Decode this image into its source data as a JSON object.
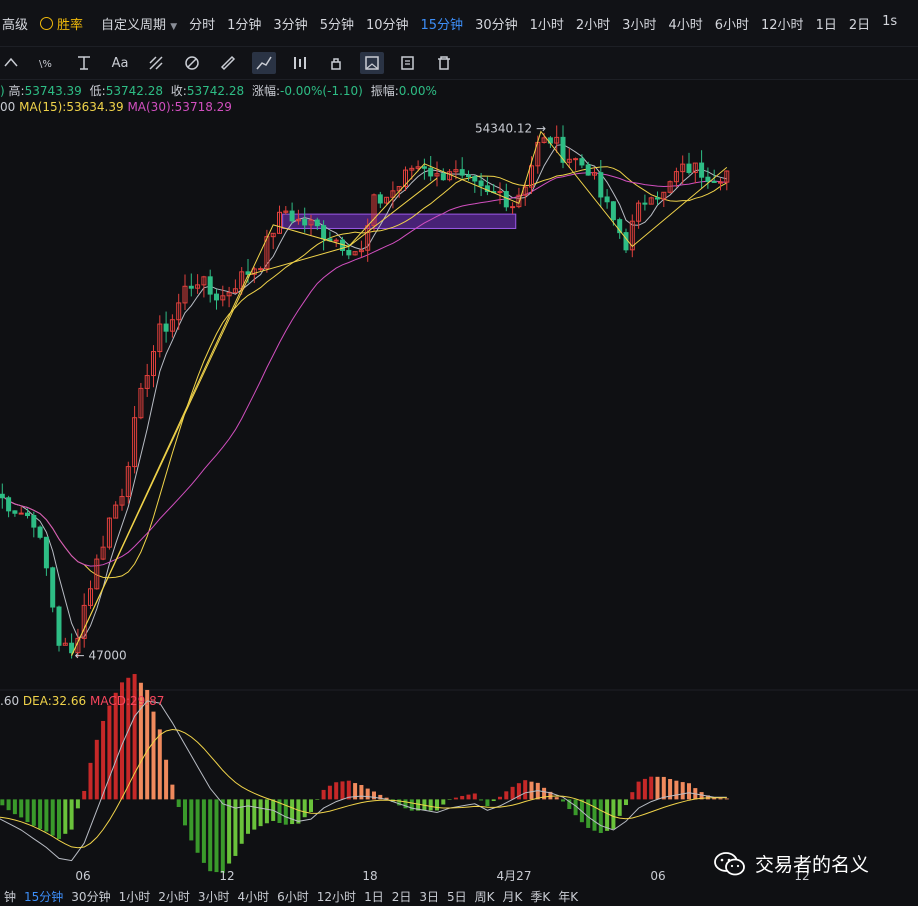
{
  "topbar": {
    "advanced": "高级",
    "winrate": "胜率",
    "custom_period": "自定义周期",
    "periods": [
      "分时",
      "1分钟",
      "3分钟",
      "5分钟",
      "10分钟",
      "15分钟",
      "30分钟",
      "1小时",
      "2小时",
      "3小时",
      "4小时",
      "6小时",
      "12小时",
      "1日",
      "2日",
      "1s"
    ],
    "active_period": "15分钟"
  },
  "toolbar": {
    "tools": [
      "line-tool-icon",
      "fib-tool-icon",
      "text-tool-icon",
      "font-tool-icon",
      "pattern-tool-icon",
      "shape-tool-icon",
      "ruler-tool-icon",
      "trend-tool-icon",
      "bars-tool-icon",
      "lock-tool-icon",
      "box-tool-icon",
      "note-tool-icon",
      "trash-icon"
    ],
    "text_tool": "Aa"
  },
  "ohlc": {
    "high_label": "高:",
    "high": "53743.39",
    "low_label": "低:",
    "low": "53742.28",
    "close_label": "收:",
    "close": "53742.28",
    "change_label": "涨幅:",
    "change": "-0.00%(-1.10)",
    "amp_label": "振幅:",
    "amp": "0.00%"
  },
  "ma": {
    "prefix": "00",
    "ma15": "MA(15):53634.39",
    "ma30": "MA(30):53718.29"
  },
  "macd_info": {
    "dif": ".60",
    "dea": "DEA:32.66",
    "macd": "MACD:29.87"
  },
  "annotations": {
    "high_label": "54340.12 →",
    "low_label": "← 47000"
  },
  "x_ticks": [
    "06",
    "12",
    "18",
    "4月27",
    "06",
    "12"
  ],
  "bottombar": {
    "items": [
      "钟",
      "15分钟",
      "30分钟",
      "1小时",
      "2小时",
      "3小时",
      "4小时",
      "6小时",
      "12小时",
      "1日",
      "2日",
      "3日",
      "5日",
      "周K",
      "月K",
      "季K",
      "年K"
    ],
    "active": "15分钟"
  },
  "watermark": "交易者的名义",
  "colors": {
    "up": "#e0403c",
    "down": "#2ebd85",
    "ma15": "#f0d34a",
    "ma30": "#d14fbf",
    "ma5": "#c9ccd3",
    "active": "#3d8ef7"
  },
  "chart_data": {
    "type": "candlestick",
    "x_ticks": [
      "06",
      "12",
      "18",
      "4月27",
      "06",
      "12"
    ],
    "y_range": [
      46800,
      54600
    ],
    "annotated_high": 54340.12,
    "annotated_low": 47000,
    "price_path": [
      [
        0,
        49250
      ],
      [
        3,
        49050
      ],
      [
        6,
        48900
      ],
      [
        8,
        48200
      ],
      [
        10,
        47200
      ],
      [
        12,
        47000
      ],
      [
        14,
        47700
      ],
      [
        16,
        48300
      ],
      [
        18,
        48900
      ],
      [
        20,
        49300
      ],
      [
        22,
        50200
      ],
      [
        24,
        51000
      ],
      [
        26,
        51500
      ],
      [
        28,
        51700
      ],
      [
        30,
        52100
      ],
      [
        32,
        52250
      ],
      [
        34,
        52050
      ],
      [
        36,
        52000
      ],
      [
        38,
        52200
      ],
      [
        40,
        52350
      ],
      [
        42,
        52500
      ],
      [
        44,
        52950
      ],
      [
        46,
        53200
      ],
      [
        48,
        53050
      ],
      [
        50,
        53000
      ],
      [
        52,
        52900
      ],
      [
        54,
        52800
      ],
      [
        56,
        52700
      ],
      [
        58,
        52600
      ],
      [
        60,
        53300
      ],
      [
        62,
        53400
      ],
      [
        64,
        53550
      ],
      [
        66,
        53800
      ],
      [
        68,
        53850
      ],
      [
        70,
        53650
      ],
      [
        72,
        53800
      ],
      [
        74,
        53600
      ],
      [
        76,
        53500
      ],
      [
        78,
        53400
      ],
      [
        80,
        53450
      ],
      [
        82,
        53300
      ],
      [
        84,
        53600
      ],
      [
        86,
        54100
      ],
      [
        88,
        54200
      ],
      [
        90,
        54000
      ],
      [
        92,
        53900
      ],
      [
        94,
        53800
      ],
      [
        96,
        53400
      ],
      [
        98,
        53050
      ],
      [
        100,
        52750
      ],
      [
        102,
        53200
      ],
      [
        104,
        53500
      ],
      [
        106,
        53400
      ],
      [
        108,
        53700
      ],
      [
        110,
        53800
      ],
      [
        112,
        53750
      ],
      [
        114,
        53700
      ],
      [
        116,
        53740
      ]
    ],
    "macd_path": [
      [
        0,
        -8
      ],
      [
        4,
        -14
      ],
      [
        8,
        -22
      ],
      [
        10,
        -27
      ],
      [
        12,
        -28
      ],
      [
        14,
        -20
      ],
      [
        16,
        -5
      ],
      [
        18,
        10
      ],
      [
        20,
        25
      ],
      [
        22,
        38
      ],
      [
        24,
        45
      ],
      [
        26,
        44
      ],
      [
        28,
        35
      ],
      [
        30,
        25
      ],
      [
        32,
        15
      ],
      [
        34,
        5
      ],
      [
        36,
        -2
      ],
      [
        38,
        -4
      ],
      [
        40,
        -3
      ],
      [
        42,
        -4
      ],
      [
        44,
        -5
      ],
      [
        46,
        -8
      ],
      [
        48,
        -10
      ],
      [
        50,
        -9
      ],
      [
        52,
        -4
      ],
      [
        54,
        -1
      ],
      [
        56,
        1
      ],
      [
        58,
        1.5
      ],
      [
        60,
        1
      ],
      [
        62,
        0
      ],
      [
        64,
        -2
      ],
      [
        66,
        -4
      ],
      [
        68,
        -5
      ],
      [
        70,
        -6
      ],
      [
        72,
        -4
      ],
      [
        74,
        -3
      ],
      [
        76,
        -2
      ],
      [
        78,
        -5
      ],
      [
        80,
        -3
      ],
      [
        82,
        0
      ],
      [
        84,
        3
      ],
      [
        86,
        4
      ],
      [
        88,
        3
      ],
      [
        90,
        1
      ],
      [
        92,
        -3
      ],
      [
        94,
        -8
      ],
      [
        96,
        -12
      ],
      [
        98,
        -14
      ],
      [
        100,
        -10
      ],
      [
        102,
        -4
      ],
      [
        104,
        -1
      ],
      [
        106,
        1
      ],
      [
        108,
        2
      ],
      [
        110,
        3
      ],
      [
        112,
        2
      ],
      [
        114,
        1
      ],
      [
        116,
        1
      ]
    ],
    "macd_range": [
      -30,
      50
    ]
  }
}
